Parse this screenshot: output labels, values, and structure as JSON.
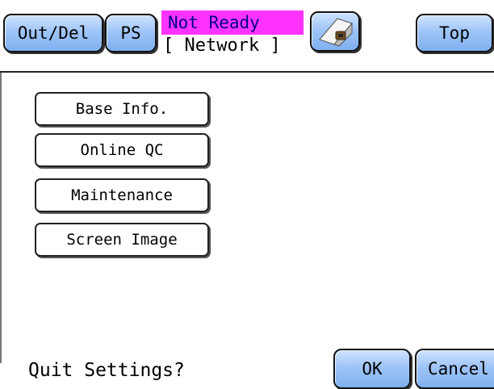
{
  "header": {
    "out_del_label": "Out/Del",
    "ps_label": "PS",
    "status": "Not Ready",
    "mode": "[ Network ]",
    "printer_icon": "printer-paper-roll-icon",
    "top_label": "Top"
  },
  "menu": {
    "items": [
      {
        "label": "Base Info."
      },
      {
        "label": "Online QC"
      },
      {
        "label": "Maintenance"
      },
      {
        "label": "Screen Image"
      }
    ]
  },
  "footer": {
    "prompt": "Quit Settings?",
    "ok_label": "OK",
    "cancel_label": "Cancel"
  },
  "colors": {
    "button_blue": "#9fc5f7",
    "status_background": "#ff33ff",
    "status_text": "#00008b",
    "background": "#ffffff"
  }
}
